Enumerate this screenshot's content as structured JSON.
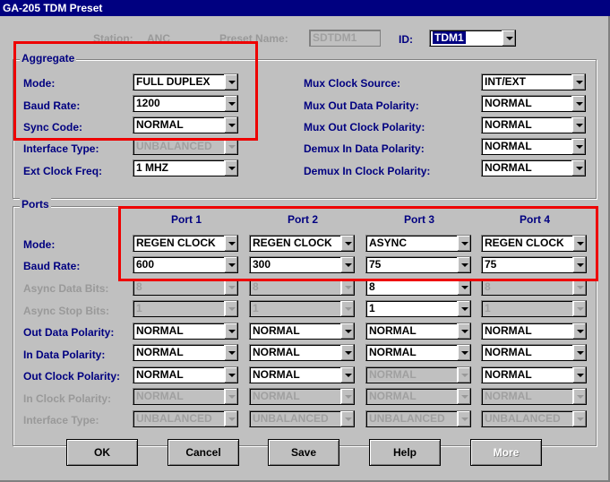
{
  "window": {
    "title": "GA-205 TDM Preset"
  },
  "header": {
    "station_label": "Station:",
    "station_value": "ANC",
    "preset_label": "Preset Name:",
    "preset_value": "SDTDM1",
    "id_label": "ID:",
    "id_value": "TDM1"
  },
  "aggregate": {
    "title": "Aggregate",
    "mode_label": "Mode:",
    "mode_value": "FULL DUPLEX",
    "baud_label": "Baud Rate:",
    "baud_value": "1200",
    "sync_label": "Sync Code:",
    "sync_value": "NORMAL",
    "iface_label": "Interface Type:",
    "iface_value": "UNBALANCED",
    "extclk_label": "Ext Clock Freq:",
    "extclk_value": "1 MHZ",
    "mux_clk_src_label": "Mux Clock Source:",
    "mux_clk_src_value": "INT/EXT",
    "mux_out_data_label": "Mux Out Data Polarity:",
    "mux_out_data_value": "NORMAL",
    "mux_out_clk_label": "Mux Out Clock Polarity:",
    "mux_out_clk_value": "NORMAL",
    "demux_in_data_label": "Demux In Data Polarity:",
    "demux_in_data_value": "NORMAL",
    "demux_in_clk_label": "Demux In Clock Polarity:",
    "demux_in_clk_value": "NORMAL"
  },
  "ports": {
    "title": "Ports",
    "headers": [
      "Port 1",
      "Port 2",
      "Port 3",
      "Port 4"
    ],
    "row_labels": {
      "mode": "Mode:",
      "baud": "Baud Rate:",
      "async_data": "Async Data Bits:",
      "async_stop": "Async Stop Bits:",
      "out_data": "Out Data Polarity:",
      "in_data": "In Data Polarity:",
      "out_clk": "Out Clock Polarity:",
      "in_clk": "In Clock Polarity:",
      "iface": "Interface Type:"
    },
    "p1": {
      "mode": "REGEN CLOCK",
      "baud": "600",
      "async_data": "8",
      "async_stop": "1",
      "out_data": "NORMAL",
      "in_data": "NORMAL",
      "out_clk": "NORMAL",
      "in_clk": "NORMAL",
      "iface": "UNBALANCED"
    },
    "p2": {
      "mode": "REGEN CLOCK",
      "baud": "300",
      "async_data": "8",
      "async_stop": "1",
      "out_data": "NORMAL",
      "in_data": "NORMAL",
      "out_clk": "NORMAL",
      "in_clk": "NORMAL",
      "iface": "UNBALANCED"
    },
    "p3": {
      "mode": "ASYNC",
      "baud": "75",
      "async_data": "8",
      "async_stop": "1",
      "out_data": "NORMAL",
      "in_data": "NORMAL",
      "out_clk": "NORMAL",
      "in_clk": "NORMAL",
      "iface": "UNBALANCED"
    },
    "p4": {
      "mode": "REGEN CLOCK",
      "baud": "75",
      "async_data": "8",
      "async_stop": "1",
      "out_data": "NORMAL",
      "in_data": "NORMAL",
      "out_clk": "NORMAL",
      "in_clk": "NORMAL",
      "iface": "UNBALANCED"
    }
  },
  "buttons": {
    "ok": "OK",
    "cancel": "Cancel",
    "save": "Save",
    "help": "Help",
    "more": "More"
  },
  "colors": {
    "titlebar": "#000080",
    "label": "#000080",
    "highlight": "#e00000"
  }
}
